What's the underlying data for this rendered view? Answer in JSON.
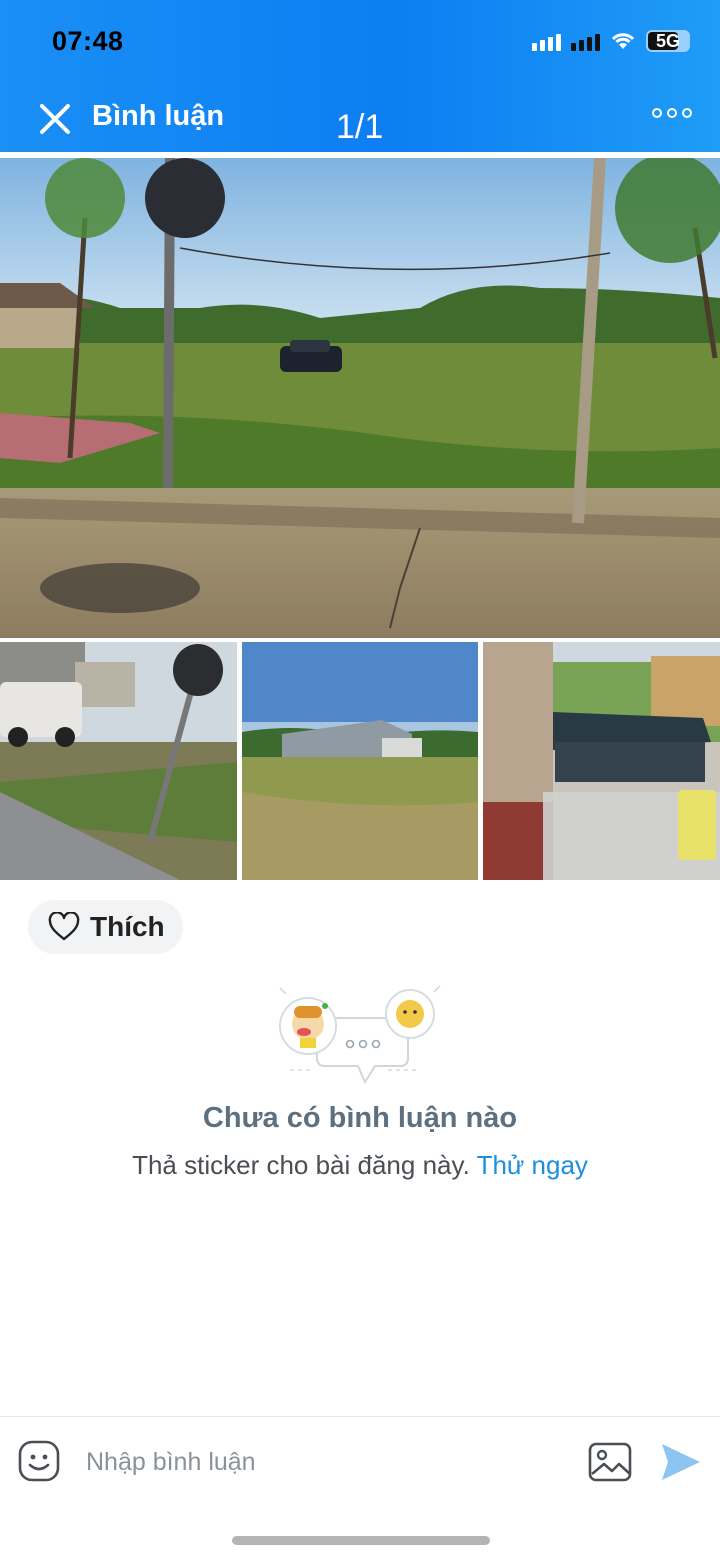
{
  "status_bar": {
    "time": "07:48",
    "network": "5G"
  },
  "header": {
    "title": "Bình luận",
    "counter": "1/1"
  },
  "like": {
    "label": "Thích"
  },
  "empty_state": {
    "title": "Chưa có bình luận nào",
    "subtitle": "Thả sticker cho bài đăng này.",
    "action": "Thử ngay"
  },
  "composer": {
    "placeholder": "Nhập bình luận"
  },
  "icons": {
    "close": "close-icon",
    "more": "more-icon",
    "like": "heart-icon",
    "sticker": "sticker-icon",
    "image": "image-icon",
    "send": "send-icon"
  },
  "colors": {
    "header": "#0c7ef2",
    "link": "#1b8fe0",
    "send": "#8cc4f2"
  }
}
